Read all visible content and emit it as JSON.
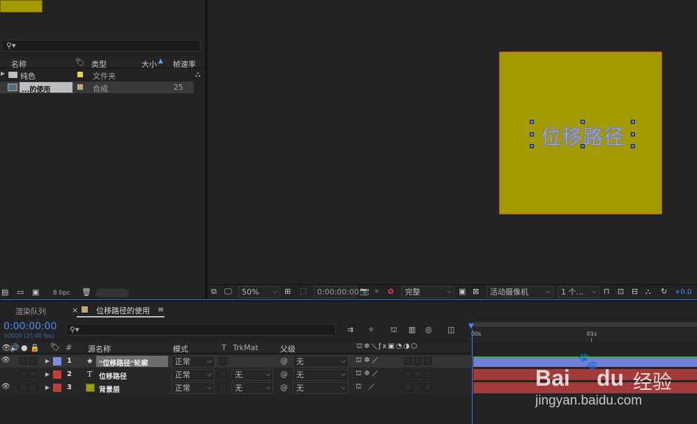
{
  "project": {
    "columns": {
      "name": "名称",
      "type": "类型",
      "size": "大小",
      "fps": "帧速率"
    },
    "items": [
      {
        "name": "纯色",
        "type": "文件夹",
        "fps": "",
        "label_color": "#e5d547"
      },
      {
        "name": "...的使用",
        "type": "合成",
        "fps": "25",
        "label_color": "#c8a47a"
      }
    ],
    "bpc": "8 bpc"
  },
  "viewer": {
    "text": "位移路径",
    "zoom": "50%",
    "time": "0:00:00:00",
    "quality": "完整",
    "camera": "活动摄像机",
    "views": "1 个...",
    "exposure": "+0.0",
    "canvas_color": "#a39a00"
  },
  "panels": {
    "render_queue": "渲染队列",
    "comp_tab": "位移路径的使用",
    "close": "×",
    "menu": "≡"
  },
  "timeline": {
    "timecode": "0:00:00:00",
    "fps_info": "00000 (25.00 fps)",
    "ruler": {
      "start": "00s",
      "mark": "01s"
    },
    "headers": {
      "num": "#",
      "source": "源名称",
      "mode": "模式",
      "t": "T",
      "trkmat": "TrkMat",
      "parent": "父级"
    },
    "layers": [
      {
        "num": "1",
        "icon": "★",
        "name": "\"位移路径\"轮廓",
        "mode": "正常",
        "trkmat": "",
        "parent": "无",
        "color": "#7b8fe0",
        "bar": "#6d7fd6"
      },
      {
        "num": "2",
        "icon": "T",
        "name": "位移路径",
        "mode": "正常",
        "trkmat": "无",
        "parent": "无",
        "color": "#c43b3b",
        "bar": "#a23a3a"
      },
      {
        "num": "3",
        "icon": "",
        "name": "背景层",
        "mode": "正常",
        "trkmat": "无",
        "parent": "无",
        "color": "#c43b3b",
        "bar": "#a23a3a"
      }
    ]
  },
  "watermark": {
    "brand": "Bai",
    "brand2": "du",
    "cn": "经验",
    "url": "jingyan.baidu.com"
  }
}
